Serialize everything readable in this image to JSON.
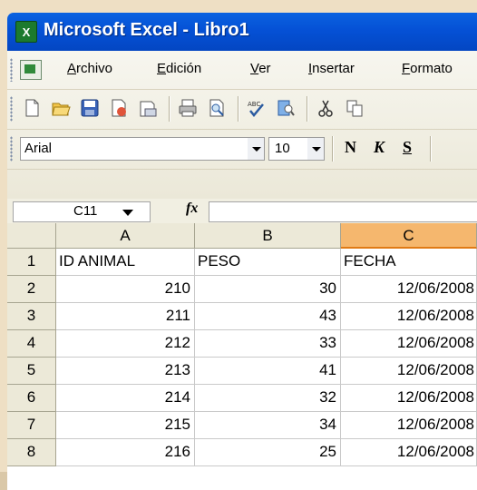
{
  "window": {
    "title": "Microsoft Excel - Libro1",
    "icon": "excel-icon",
    "title_bar_color": "#0551d6"
  },
  "menu": {
    "items": [
      {
        "pre": "",
        "u": "A",
        "rest": "rchivo"
      },
      {
        "pre": "",
        "u": "E",
        "rest": "dición"
      },
      {
        "pre": "",
        "u": "V",
        "rest": "er"
      },
      {
        "pre": "",
        "u": "I",
        "rest": "nsertar"
      },
      {
        "pre": "",
        "u": "F",
        "rest": "ormato"
      }
    ]
  },
  "toolbar": {
    "icons": [
      "new-icon",
      "open-icon",
      "save-icon",
      "permission-icon",
      "email-icon",
      "print-icon",
      "print-preview-icon",
      "spelling-icon",
      "research-icon",
      "cut-icon",
      "copy-icon"
    ]
  },
  "format_bar": {
    "font": "Arial",
    "size": "10",
    "bold": "N",
    "italic": "K",
    "underline": "S"
  },
  "formula_bar": {
    "name_box": "C11",
    "fx": "fx",
    "value": ""
  },
  "sheet": {
    "columns": [
      "A",
      "B",
      "C"
    ],
    "selected_column": "C",
    "row_numbers": [
      "1",
      "2",
      "3",
      "4",
      "5",
      "6",
      "7",
      "8"
    ],
    "header_row": [
      "ID ANIMAL",
      "PESO",
      "FECHA"
    ],
    "rows": [
      [
        "210",
        "30",
        "12/06/2008"
      ],
      [
        "211",
        "43",
        "12/06/2008"
      ],
      [
        "212",
        "33",
        "12/06/2008"
      ],
      [
        "213",
        "41",
        "12/06/2008"
      ],
      [
        "214",
        "32",
        "12/06/2008"
      ],
      [
        "215",
        "34",
        "12/06/2008"
      ],
      [
        "216",
        "25",
        "12/06/2008"
      ]
    ]
  }
}
